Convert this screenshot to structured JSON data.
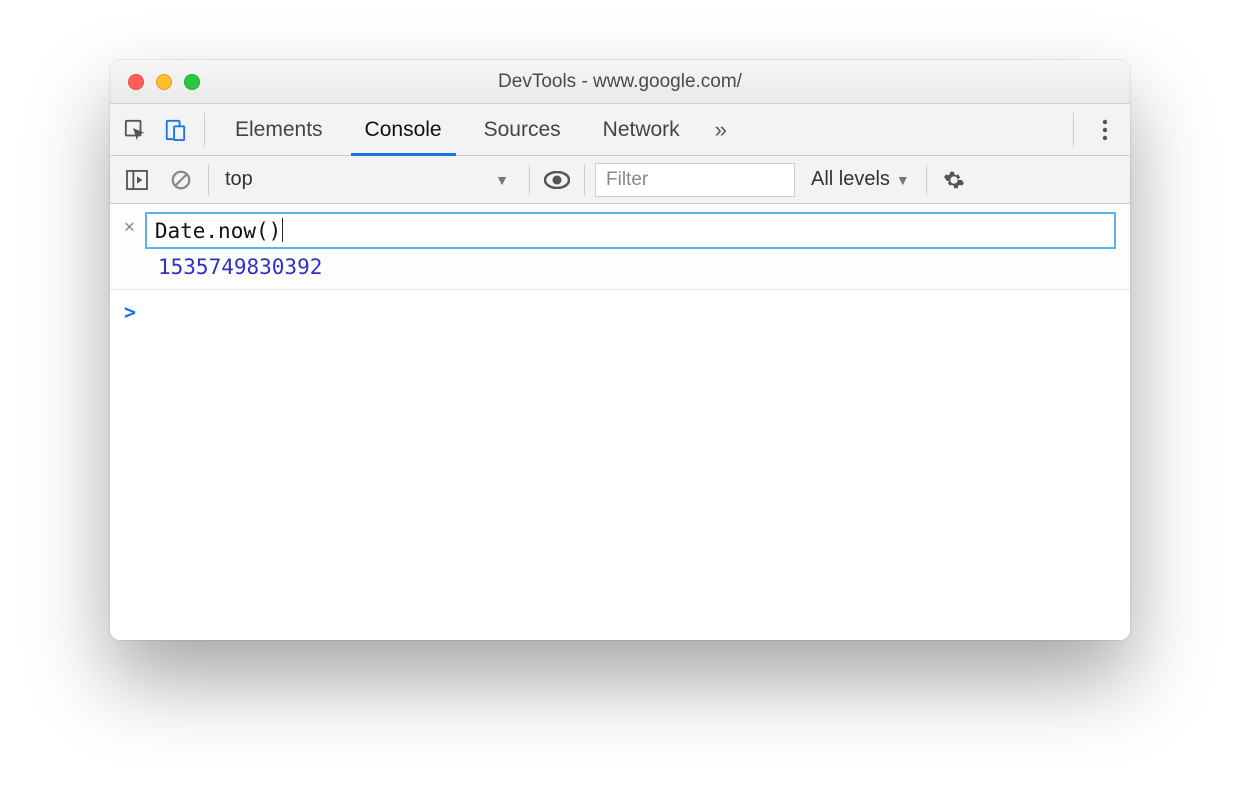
{
  "window": {
    "title": "DevTools - www.google.com/"
  },
  "tabs": {
    "elements": "Elements",
    "console": "Console",
    "sources": "Sources",
    "network": "Network",
    "overflow_glyph": "»"
  },
  "filterbar": {
    "context": "top",
    "filter_placeholder": "Filter",
    "levels_label": "All levels"
  },
  "console": {
    "expression": "Date.now()",
    "result": "1535749830392",
    "prompt": ">"
  }
}
